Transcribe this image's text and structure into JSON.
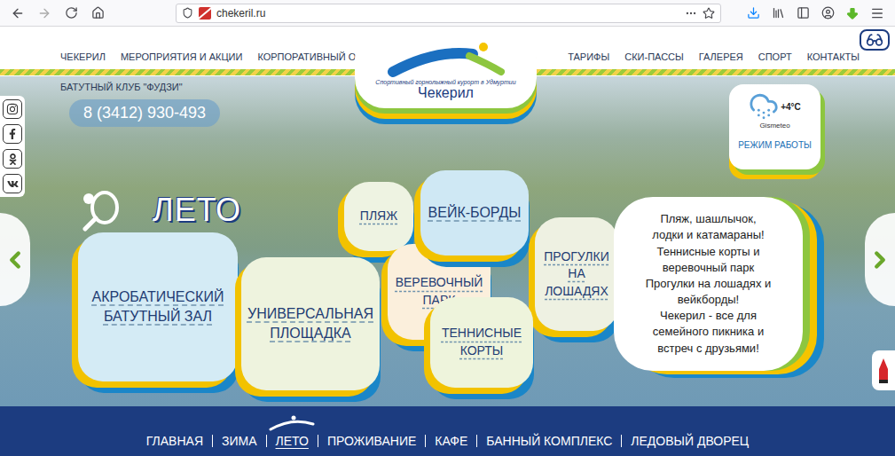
{
  "browser": {
    "url": "chekeril.ru"
  },
  "header": {
    "nav_left": [
      "ЧЕКЕРИЛ",
      "МЕРОПРИЯТИЯ И АКЦИИ",
      "КОРПОРАТИВНЫЙ ОТДЫХ"
    ],
    "nav_right": [
      "ТАРИФЫ",
      "СКИ-ПАССЫ",
      "ГАЛЕРЕЯ",
      "СПОРТ",
      "КОНТАКТЫ"
    ]
  },
  "logo": {
    "subtitle": "Спортивный горнолыжный курорт в Удмуртии",
    "title": "Чекерил"
  },
  "club": "БАТУТНЫЙ КЛУБ \"ФУДЗИ\"",
  "phone": "8 (3412) 930-493",
  "weather": {
    "temperature": "+4°C",
    "source": "Gismeteo",
    "link": "РЕЖИМ РАБОТЫ"
  },
  "section": {
    "title": "ЛЕТО"
  },
  "tiles": [
    {
      "label": "ПЛЯЖ",
      "color": "#eef3e2"
    },
    {
      "label": "ВЕРЕВОЧНЫЙ ПАРК",
      "color": "#fbefdc"
    },
    {
      "label": "ВЕЙК-БОРДЫ",
      "color": "#cfe8f4"
    },
    {
      "label": "АКРОБАТИЧЕСКИЙ БАТУТНЫЙ ЗАЛ",
      "color": "#d4ebf5"
    },
    {
      "label": "УНИВЕРСАЛЬНАЯ ПЛОЩАДКА",
      "color": "#eef3de"
    },
    {
      "label": "ПРОГУЛКИ НА ЛОШАДЯХ",
      "color": "#eef1e2"
    },
    {
      "label": "ТЕННИСНЫЕ КОРТЫ",
      "color": "#eef4dc"
    }
  ],
  "promo": {
    "lines": [
      "Пляж, шашлычок,",
      "лодки и катамараны!",
      "Теннисные корты и",
      "веревочный парк",
      "Прогулки на лошадях и",
      "вейкборды!",
      "Чекерил - все для",
      "семейного пикника и",
      "встреч с друзьями!"
    ]
  },
  "bottom_nav": [
    {
      "label": "ГЛАВНАЯ",
      "selected": false
    },
    {
      "label": "ЗИМА",
      "selected": false
    },
    {
      "label": "ЛЕТО",
      "selected": true
    },
    {
      "label": "ПРОЖИВАНИЕ",
      "selected": false
    },
    {
      "label": "КАФЕ",
      "selected": false
    },
    {
      "label": "БАННЫЙ КОМПЛЕКС",
      "selected": false
    },
    {
      "label": "ЛЕДОВЫЙ ДВОРЕЦ",
      "selected": false
    }
  ]
}
